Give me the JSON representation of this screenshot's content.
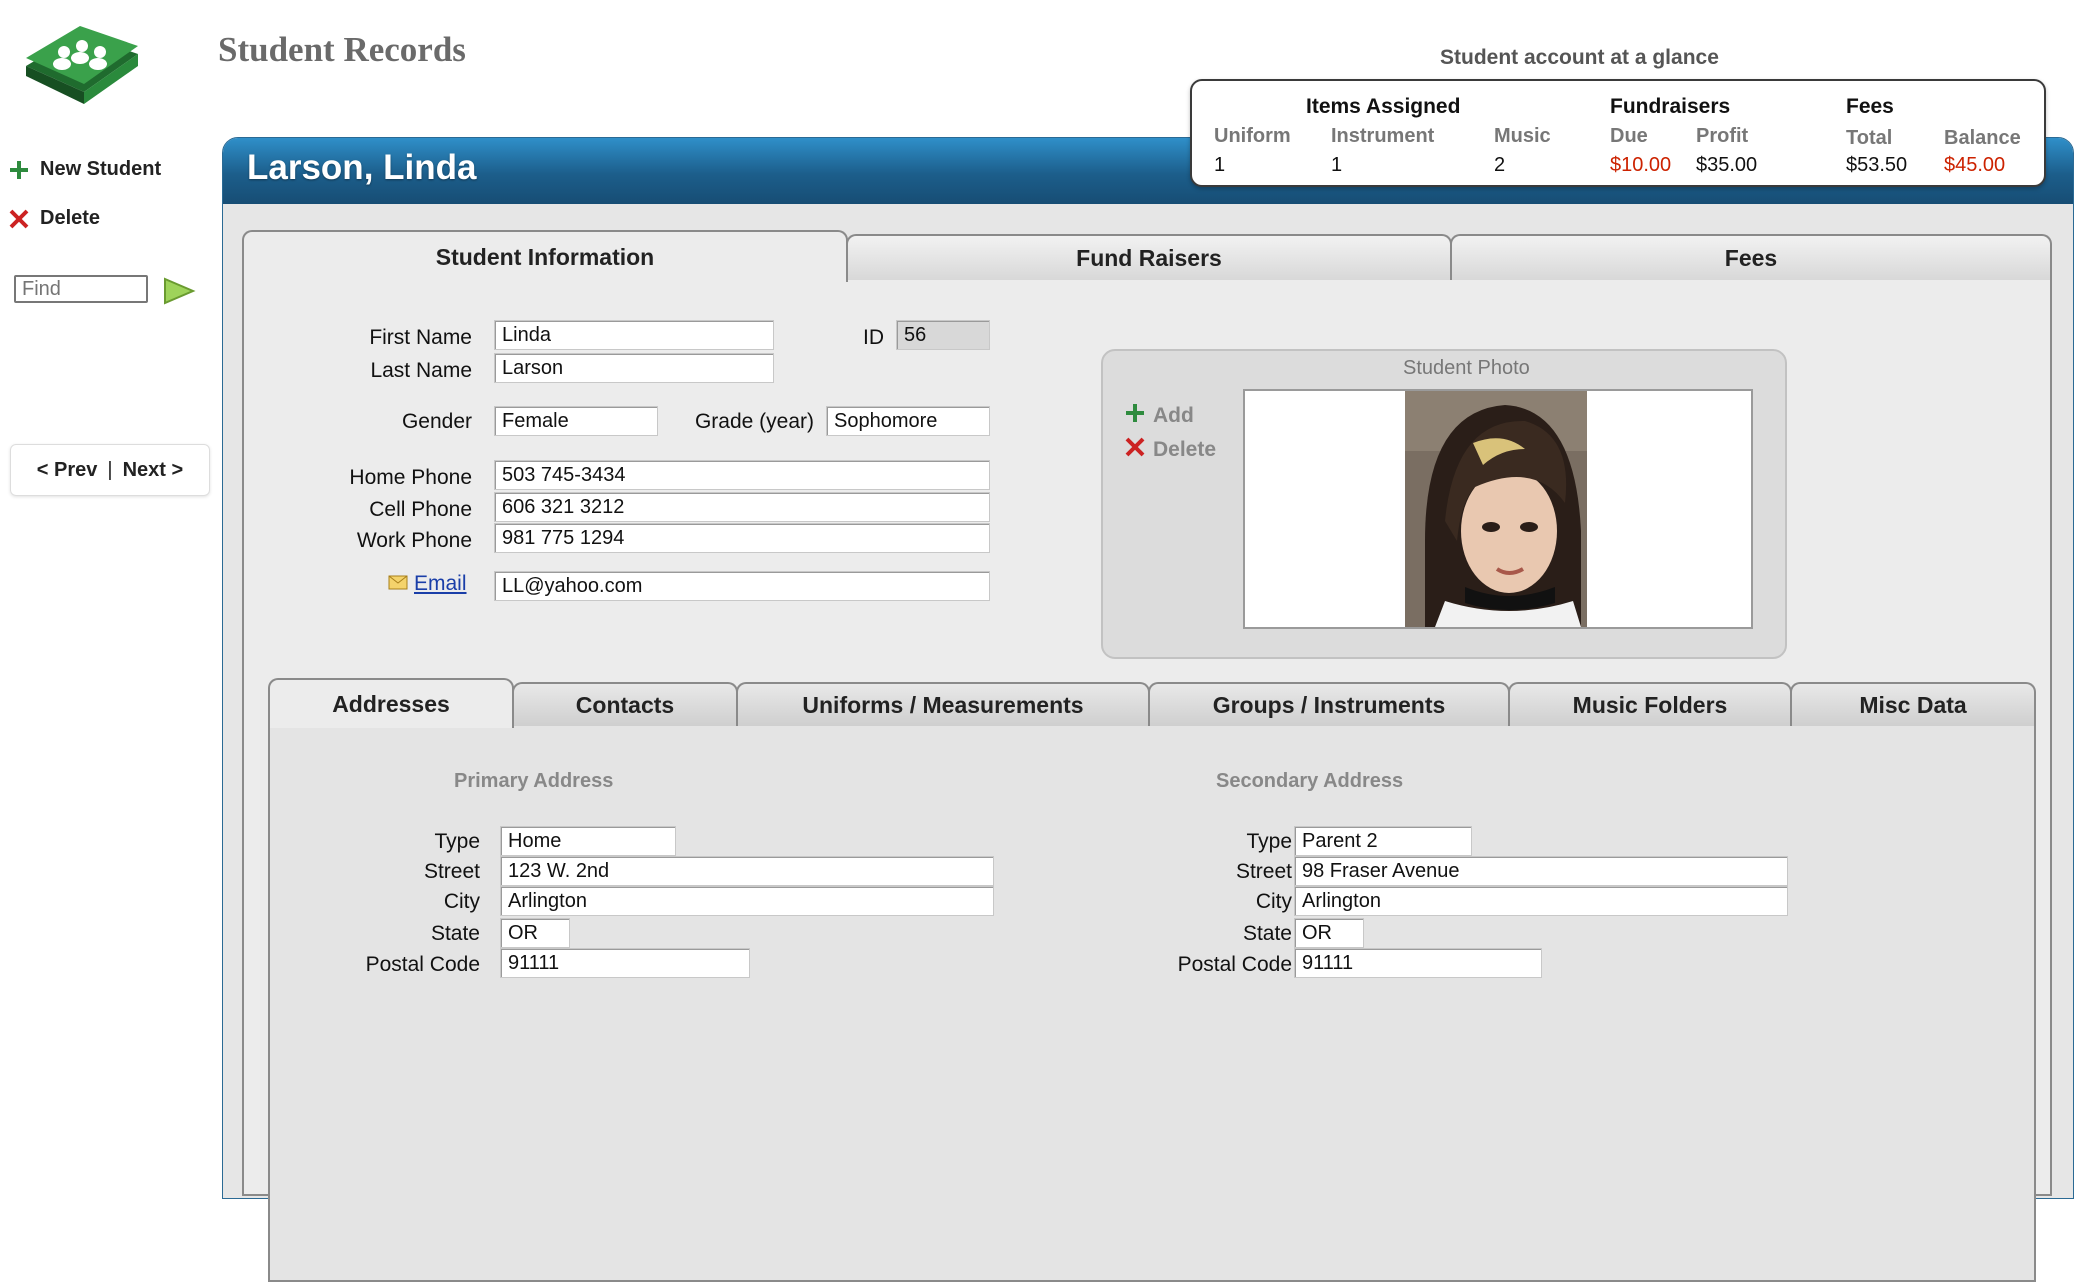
{
  "app": {
    "title": "Student Records"
  },
  "sidebar": {
    "new_student": "New Student",
    "delete": "Delete",
    "find_placeholder": "Find",
    "prev": "< Prev",
    "separator": "|",
    "next": "Next >"
  },
  "header": {
    "student_name": "Larson, Linda"
  },
  "glance": {
    "title": "Student account at a glance",
    "items_assigned": {
      "label": "Items Assigned",
      "uniform_label": "Uniform",
      "uniform": "1",
      "instrument_label": "Instrument",
      "instrument": "1",
      "music_label": "Music",
      "music": "2"
    },
    "fundraisers": {
      "label": "Fundraisers",
      "due_label": "Due",
      "due": "$10.00",
      "profit_label": "Profit",
      "profit": "$35.00"
    },
    "fees": {
      "label": "Fees",
      "total_label": "Total",
      "total": "$53.50",
      "balance_label": "Balance",
      "balance": "$45.00"
    },
    "colors": {
      "alert": "#cc2200"
    }
  },
  "upper_tabs": [
    "Student Information",
    "Fund Raisers",
    "Fees"
  ],
  "student": {
    "first_name_label": "First Name",
    "first_name": "Linda",
    "last_name_label": "Last Name",
    "last_name": "Larson",
    "id_label": "ID",
    "id": "56",
    "gender_label": "Gender",
    "gender": "Female",
    "grade_label": "Grade (year)",
    "grade": "Sophomore",
    "home_phone_label": "Home Phone",
    "home_phone": "503 745-3434",
    "cell_phone_label": "Cell Phone",
    "cell_phone": "606 321 3212",
    "work_phone_label": "Work Phone",
    "work_phone": "981 775 1294",
    "email_label": "Email",
    "email": "LL@yahoo.com"
  },
  "photo": {
    "label": "Student Photo",
    "add": "Add",
    "delete": "Delete"
  },
  "lower_tabs": [
    "Addresses",
    "Contacts",
    "Uniforms / Measurements",
    "Groups / Instruments",
    "Music Folders",
    "Misc Data"
  ],
  "addresses": {
    "labels": {
      "type": "Type",
      "street": "Street",
      "city": "City",
      "state": "State",
      "postal": "Postal Code"
    },
    "primary": {
      "title": "Primary Address",
      "type": "Home",
      "street": "123 W. 2nd",
      "city": "Arlington",
      "state": "OR",
      "postal": "91111"
    },
    "secondary": {
      "title": "Secondary Address",
      "type": "Parent 2",
      "street": "98 Fraser Avenue",
      "city": "Arlington",
      "state": "OR",
      "postal": "91111"
    }
  },
  "colors": {
    "header_blue": "#1c5e8b",
    "accent_green": "#2e8b3e",
    "delete_red": "#cc2222"
  }
}
